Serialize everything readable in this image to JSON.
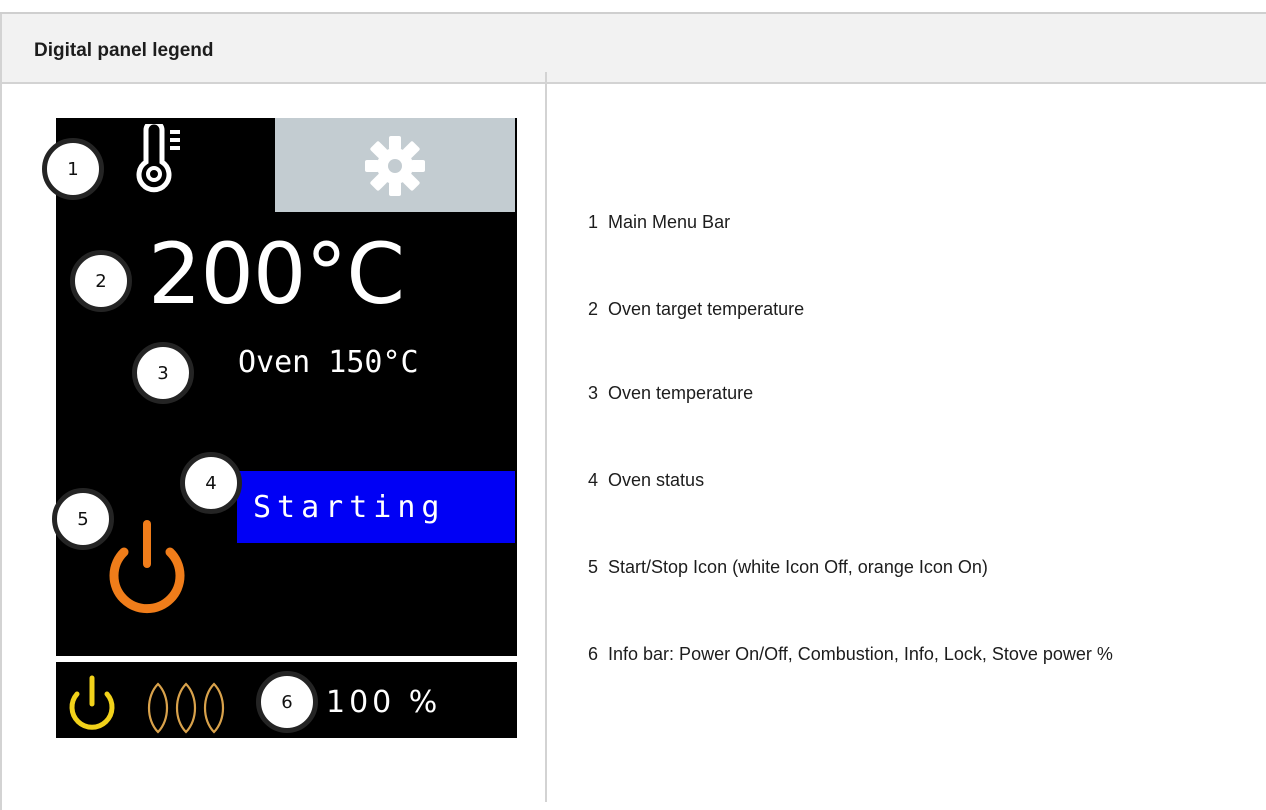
{
  "header": {
    "title": "Digital panel legend"
  },
  "panel": {
    "target_temp": "200°C",
    "oven_temp": "Oven 150°C",
    "status": "Starting",
    "power_percent": "100 %",
    "badges": [
      "1",
      "2",
      "3",
      "4",
      "5",
      "6"
    ],
    "colors": {
      "status_bg": "#0000f5",
      "start_icon": "#f07d1a",
      "power_icon": "#f2d21a",
      "flame_icon": "#d9a24b",
      "settings_tile": "#c3ccd1"
    },
    "icons": [
      "thermometer-icon",
      "gear-icon",
      "start-stop-icon",
      "power-icon",
      "combustion-icon"
    ]
  },
  "legend": [
    {
      "num": "1",
      "text": "Main Menu Bar"
    },
    {
      "num": "2",
      "text": "Oven target temperature"
    },
    {
      "num": "3",
      "text": "Oven temperature"
    },
    {
      "num": "4",
      "text": "Oven status"
    },
    {
      "num": "5",
      "text": "Start/Stop Icon (white Icon Off, orange Icon On)"
    },
    {
      "num": "6",
      "text": "Info bar: Power On/Off, Combustion, Info, Lock, Stove power %"
    }
  ]
}
